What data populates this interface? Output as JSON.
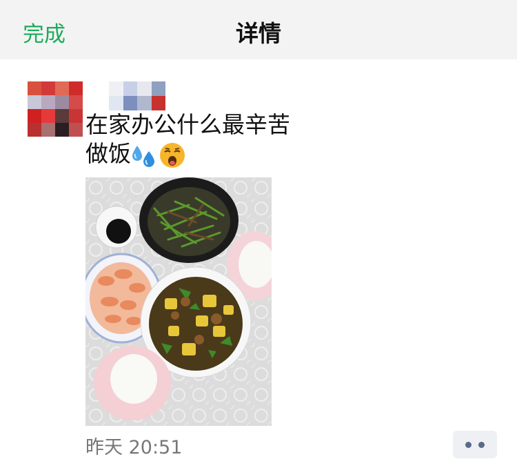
{
  "nav": {
    "done_label": "完成",
    "title": "详情",
    "accent_color": "#1aad5a"
  },
  "post": {
    "text_line1": "在家办公什么最辛苦",
    "text_line2": "做饭",
    "emojis": [
      "sweat-droplets-icon",
      "yawning-face-icon"
    ],
    "avatar": "pixelated-avatar",
    "nickname": "pixelated-nickname",
    "photo": "home-cooked-meal-photo",
    "timestamp": "昨天 20:51"
  },
  "more_button_icon": "more-dots-icon"
}
